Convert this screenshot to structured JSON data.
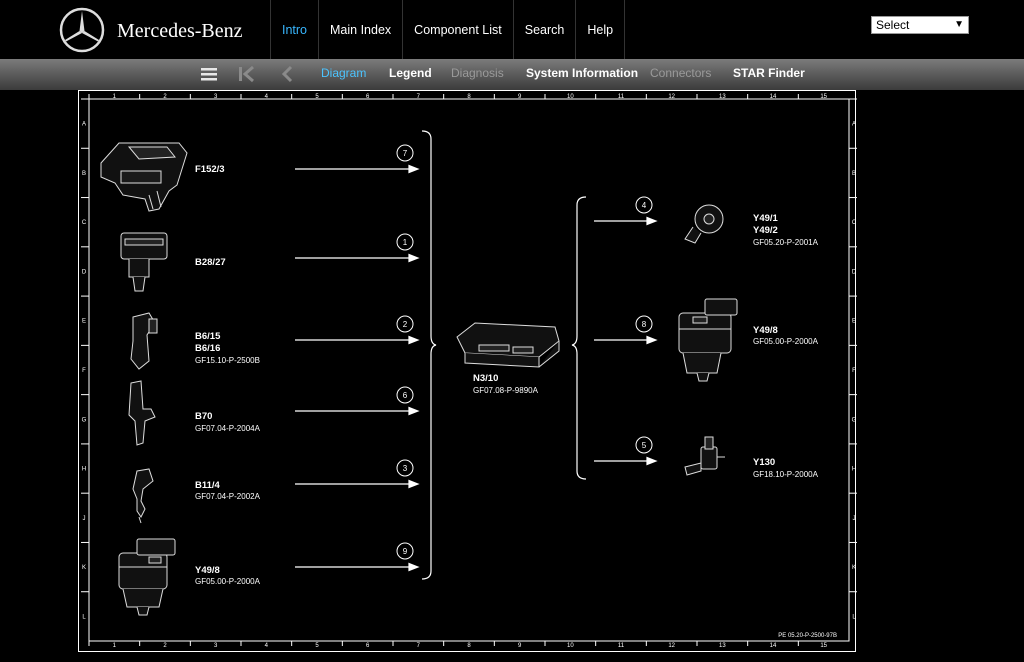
{
  "header": {
    "brand": "Mercedes-Benz",
    "nav": [
      {
        "label": "Intro",
        "active": true
      },
      {
        "label": "Main Index",
        "active": false
      },
      {
        "label": "Component List",
        "active": false
      },
      {
        "label": "Search",
        "active": false
      },
      {
        "label": "Help",
        "active": false
      }
    ],
    "select_value": "Select"
  },
  "toolbar": {
    "icons": [
      "menu-icon",
      "first-page-icon",
      "back-icon"
    ],
    "tabs": [
      {
        "label": "Diagram",
        "state": "active"
      },
      {
        "label": "Legend",
        "state": "normal"
      },
      {
        "label": "Diagnosis",
        "state": "disabled"
      },
      {
        "label": "System Information",
        "state": "normal"
      },
      {
        "label": "Connectors",
        "state": "disabled"
      },
      {
        "label": "STAR Finder",
        "state": "normal"
      }
    ]
  },
  "diagram": {
    "columns": [
      "1",
      "2",
      "3",
      "4",
      "5",
      "6",
      "7",
      "8",
      "9",
      "10",
      "11",
      "12",
      "13",
      "14",
      "15"
    ],
    "rows": [
      "A",
      "B",
      "C",
      "D",
      "E",
      "F",
      "G",
      "H",
      "J",
      "K",
      "L"
    ],
    "inputs": [
      {
        "id": "F152/3",
        "ref": "",
        "signal": "7"
      },
      {
        "id": "B28/27",
        "ref": "",
        "signal": "1"
      },
      {
        "id": "B6/15",
        "id2": "B6/16",
        "ref": "GF15.10-P-2500B",
        "signal": "2"
      },
      {
        "id": "B70",
        "ref": "GF07.04-P-2004A",
        "signal": "6"
      },
      {
        "id": "B11/4",
        "ref": "GF07.04-P-2002A",
        "signal": "3"
      },
      {
        "id": "Y49/8",
        "ref": "GF05.00-P-2000A",
        "signal": "9"
      }
    ],
    "control_unit": {
      "id": "N3/10",
      "ref": "GF07.08-P-9890A"
    },
    "outputs": [
      {
        "id": "Y49/1",
        "id2": "Y49/2",
        "ref": "GF05.20-P-2001A",
        "signal": "4"
      },
      {
        "id": "Y49/8",
        "ref": "GF05.00-P-2000A",
        "signal": "8"
      },
      {
        "id": "Y130",
        "ref": "GF18.10-P-2000A",
        "signal": "5"
      }
    ],
    "footer_code": "PE 05.20-P-2500-97B"
  }
}
